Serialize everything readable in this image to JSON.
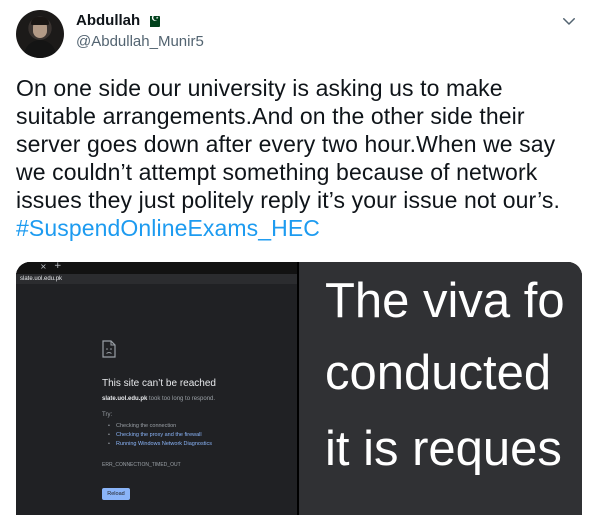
{
  "author": {
    "display_name": "Abdullah",
    "handle": "@Abdullah_Munir5",
    "flag_icon": "pakistan-flag-icon",
    "more_icon": "chevron-down-icon"
  },
  "tweet": {
    "text": "On one side our university is asking us to make suitable arrangements.And on the other side their server goes down after every two hour.When we say we couldn’t attempt something because of network issues they just politely reply it’s your issue not our’s.",
    "hashtag": "#SuspendOnlineExams_HEC"
  },
  "media": {
    "left_screenshot": {
      "tab_close": "×",
      "tab_add": "+",
      "url": "slate.uol.edu.pk",
      "error_icon": "sad-document-icon",
      "error_title": "This site can’t be reached",
      "error_host": "slate.uol.edu.pk",
      "error_desc_rest": " took too long to respond.",
      "try_label": "Try:",
      "tips": [
        "Checking the connection",
        "Checking the proxy and the firewall",
        "Running Windows Network Diagnostics"
      ],
      "error_code": "ERR_CONNECTION_TIMED_OUT",
      "reload_label": "Reload"
    },
    "right_screenshot": {
      "lines": [
        "The viva fo",
        "conducted",
        "it is reques",
        ""
      ]
    }
  },
  "colors": {
    "link": "#1d9bf0",
    "text": "#0f1419",
    "muted": "#536471",
    "chrome_dark": "#202124",
    "chrome_link": "#8ab4f8"
  }
}
